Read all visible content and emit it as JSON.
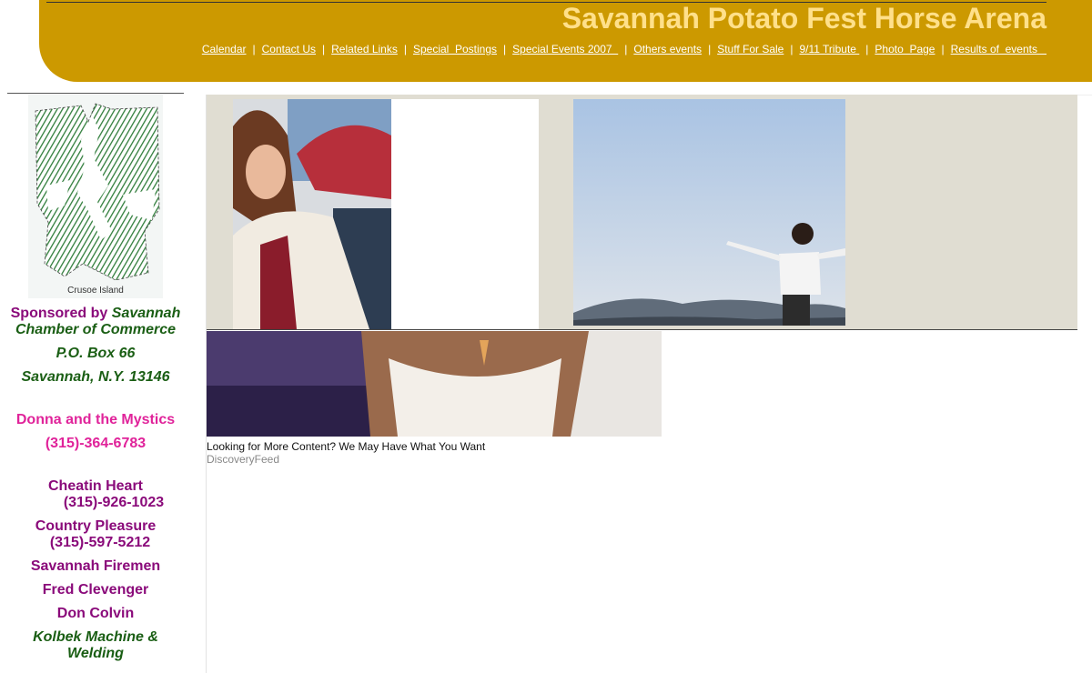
{
  "header": {
    "title": "Savannah Potato Fest Horse Arena",
    "nav": [
      {
        "label": "Calendar"
      },
      {
        "label": "Contact Us"
      },
      {
        "label": "Related Links"
      },
      {
        "label": "Special  Postings"
      },
      {
        "label": "Special Events 2007  "
      },
      {
        "label": "Others events"
      },
      {
        "label": "Stuff For Sale"
      },
      {
        "label": "9/11 Tribute "
      },
      {
        "label": "Photo  Page"
      },
      {
        "label": "Results of  events   "
      }
    ],
    "separator": "|"
  },
  "sidebar": {
    "map_caption": "Crusoe Island",
    "sponsored_prefix": "Sponsored by",
    "sponsor_name_1": "Savannah",
    "sponsor_name_2": "Chamber of Commerce",
    "po_box": "P.O. Box 66",
    "city": "Savannah, N.Y. 13146",
    "donna": "Donna and the Mystics",
    "donna_phone": "(315)-364-6783",
    "cheatin": "Cheatin Heart",
    "cheatin_phone": "(315)-926-1023",
    "country": "Country Pleasure",
    "country_phone": "(315)-597-5212",
    "firemen": "Savannah Firemen",
    "fred": "Fred Clevenger",
    "don": "Don Colvin",
    "kolbek_1": "Kolbek Machine &",
    "kolbek_2": "Welding"
  },
  "ad": {
    "caption": "Looking for More Content? We May Have What You Want",
    "source": "DiscoveryFeed"
  },
  "colors": {
    "header_bg": "#cc9900",
    "title": "#ffe08a",
    "purple": "#8a0a7a",
    "green": "#1a5e14",
    "pink": "#e0239a"
  }
}
